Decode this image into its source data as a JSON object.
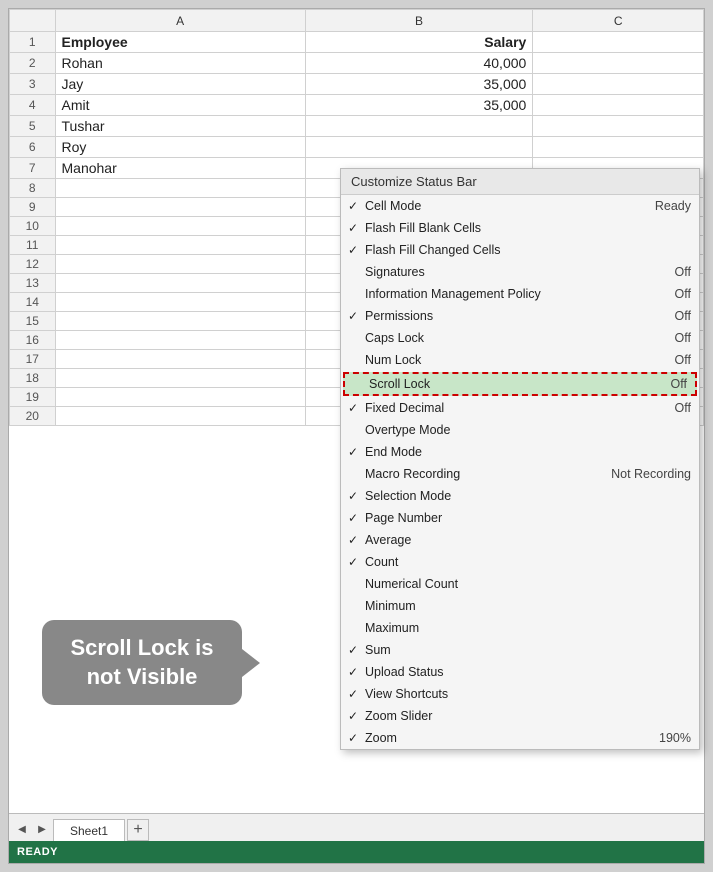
{
  "spreadsheet": {
    "columns": [
      "",
      "A",
      "B",
      "C"
    ],
    "rows": [
      {
        "num": "1",
        "a": "Employee",
        "b": "Salary",
        "a_bold": true,
        "b_bold": true
      },
      {
        "num": "2",
        "a": "Rohan",
        "b": "40,000"
      },
      {
        "num": "3",
        "a": "Jay",
        "b": "35,000"
      },
      {
        "num": "4",
        "a": "Amit",
        "b": "35,000"
      },
      {
        "num": "5",
        "a": "Tushar",
        "b": ""
      },
      {
        "num": "6",
        "a": "Roy",
        "b": ""
      },
      {
        "num": "7",
        "a": "Manohar",
        "b": ""
      },
      {
        "num": "8",
        "a": "",
        "b": ""
      },
      {
        "num": "9",
        "a": "",
        "b": ""
      },
      {
        "num": "10",
        "a": "",
        "b": ""
      },
      {
        "num": "11",
        "a": "",
        "b": ""
      },
      {
        "num": "12",
        "a": "",
        "b": ""
      },
      {
        "num": "13",
        "a": "",
        "b": ""
      },
      {
        "num": "14",
        "a": "",
        "b": ""
      },
      {
        "num": "15",
        "a": "",
        "b": ""
      },
      {
        "num": "16",
        "a": "",
        "b": ""
      },
      {
        "num": "17",
        "a": "",
        "b": ""
      },
      {
        "num": "18",
        "a": "",
        "b": ""
      },
      {
        "num": "19",
        "a": "",
        "b": ""
      },
      {
        "num": "20",
        "a": "",
        "b": ""
      }
    ]
  },
  "context_menu": {
    "title": "Customize Status Bar",
    "items": [
      {
        "label": "Cell Mode",
        "value": "Ready",
        "checked": true
      },
      {
        "label": "Flash Fill Blank Cells",
        "value": "",
        "checked": true
      },
      {
        "label": "Flash Fill Changed Cells",
        "value": "",
        "checked": true
      },
      {
        "label": "Signatures",
        "value": "Off",
        "checked": false
      },
      {
        "label": "Information Management Policy",
        "value": "Off",
        "checked": false
      },
      {
        "label": "Permissions",
        "value": "Off",
        "checked": true
      },
      {
        "label": "Caps Lock",
        "value": "Off",
        "checked": false
      },
      {
        "label": "Num Lock",
        "value": "Off",
        "checked": false
      },
      {
        "label": "Scroll Lock",
        "value": "Off",
        "checked": false,
        "highlight": true
      },
      {
        "label": "Fixed Decimal",
        "value": "Off",
        "checked": true
      },
      {
        "label": "Overtype Mode",
        "value": "",
        "checked": false
      },
      {
        "label": "End Mode",
        "value": "",
        "checked": true
      },
      {
        "label": "Macro Recording",
        "value": "Not Recording",
        "checked": false
      },
      {
        "label": "Selection Mode",
        "value": "",
        "checked": true
      },
      {
        "label": "Page Number",
        "value": "",
        "checked": true
      },
      {
        "label": "Average",
        "value": "",
        "checked": true
      },
      {
        "label": "Count",
        "value": "",
        "checked": true
      },
      {
        "label": "Numerical Count",
        "value": "",
        "checked": false
      },
      {
        "label": "Minimum",
        "value": "",
        "checked": false
      },
      {
        "label": "Maximum",
        "value": "",
        "checked": false
      },
      {
        "label": "Sum",
        "value": "",
        "checked": true
      },
      {
        "label": "Upload Status",
        "value": "",
        "checked": true
      },
      {
        "label": "View Shortcuts",
        "value": "",
        "checked": true
      },
      {
        "label": "Zoom Slider",
        "value": "",
        "checked": true
      },
      {
        "label": "Zoom",
        "value": "190%",
        "checked": true
      }
    ]
  },
  "sheet_tabs": {
    "tabs": [
      "Sheet1"
    ],
    "active": "Sheet1"
  },
  "status_bar": {
    "text": "READY"
  },
  "callout": {
    "line1": "Scroll Lock is",
    "line2": "not Visible"
  }
}
